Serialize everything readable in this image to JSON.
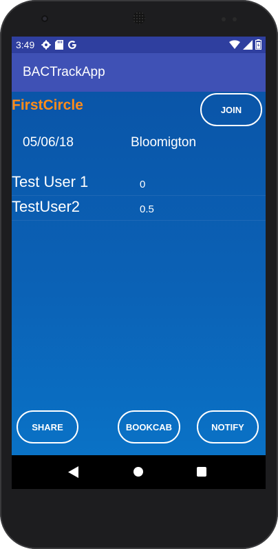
{
  "status_bar": {
    "time": "3:49",
    "left_icons": [
      "gear-icon",
      "sd-card-icon",
      "google-icon"
    ],
    "right_icons": [
      "wifi-icon",
      "signal-icon",
      "battery-icon"
    ]
  },
  "app_bar": {
    "title": "BACTrackApp"
  },
  "circle": {
    "name": "FirstCircle",
    "join_label": "JOIN",
    "date": "05/06/18",
    "location": "Bloomigton"
  },
  "users": [
    {
      "name": "Test User 1",
      "value": "0"
    },
    {
      "name": "TestUser2",
      "value": "0.5"
    }
  ],
  "actions": {
    "share_label": "SHARE",
    "bookcab_label": "BOOKCAB",
    "notify_label": "NOTIFY"
  },
  "nav_bar": {
    "icons": [
      "back-icon",
      "home-icon",
      "recents-icon"
    ]
  },
  "colors": {
    "status_bar": "#2f3f9f",
    "app_bar": "#3f51b5",
    "content_bg": "#0b62b6",
    "circle_name": "#ff8c1a"
  }
}
